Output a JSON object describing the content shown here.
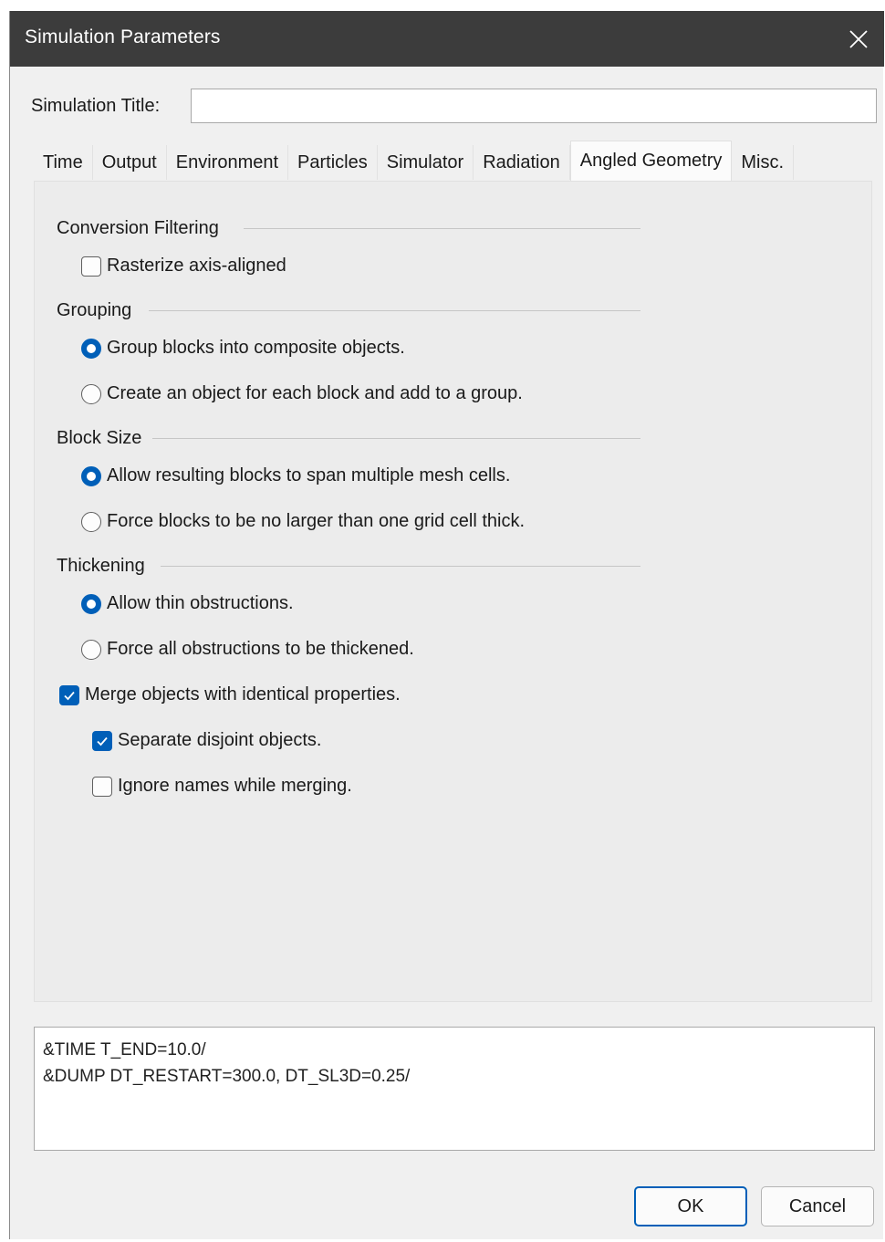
{
  "window": {
    "title": "Simulation Parameters"
  },
  "title_field": {
    "label": "Simulation Title:",
    "value": ""
  },
  "tabs": [
    {
      "label": "Time",
      "active": false
    },
    {
      "label": "Output",
      "active": false
    },
    {
      "label": "Environment",
      "active": false
    },
    {
      "label": "Particles",
      "active": false
    },
    {
      "label": "Simulator",
      "active": false
    },
    {
      "label": "Radiation",
      "active": false
    },
    {
      "label": "Angled Geometry",
      "active": true
    },
    {
      "label": "Misc.",
      "active": false
    }
  ],
  "conversion_filtering": {
    "header": "Conversion Filtering",
    "rasterize": {
      "label": "Rasterize axis-aligned",
      "checked": false
    }
  },
  "grouping": {
    "header": "Grouping",
    "options": [
      {
        "label": "Group blocks into composite objects.",
        "selected": true
      },
      {
        "label": "Create an object for each block and add to a group.",
        "selected": false
      }
    ]
  },
  "block_size": {
    "header": "Block Size",
    "options": [
      {
        "label": "Allow resulting blocks to span multiple mesh cells.",
        "selected": true
      },
      {
        "label": "Force blocks to be no larger than one grid cell thick.",
        "selected": false
      }
    ]
  },
  "thickening": {
    "header": "Thickening",
    "options": [
      {
        "label": "Allow thin obstructions.",
        "selected": true
      },
      {
        "label": "Force all obstructions to be thickened.",
        "selected": false
      }
    ]
  },
  "merge": {
    "label": "Merge objects with identical properties.",
    "checked": true,
    "separate": {
      "label": "Separate disjoint objects.",
      "checked": true
    },
    "ignore_names": {
      "label": "Ignore names while merging.",
      "checked": false
    }
  },
  "preview": {
    "lines": [
      "&TIME T_END=10.0/",
      "&DUMP DT_RESTART=300.0, DT_SL3D=0.25/"
    ]
  },
  "buttons": {
    "ok": "OK",
    "cancel": "Cancel"
  },
  "colors": {
    "accent": "#005fb8",
    "titlebar": "#3c3c3c",
    "dialog_bg": "#f0f0f0"
  },
  "icons": {
    "close": "close-icon",
    "checkmark": "checkmark-icon"
  }
}
